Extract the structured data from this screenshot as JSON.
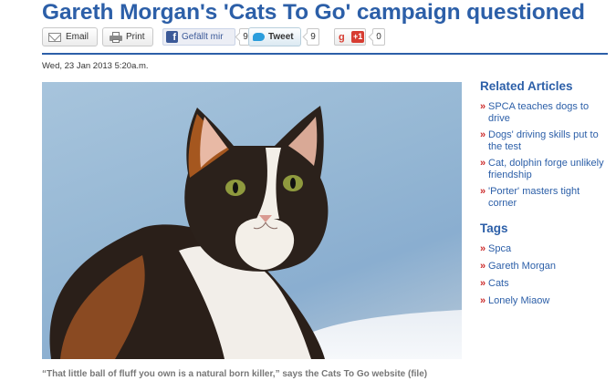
{
  "article": {
    "headline": "Gareth Morgan's 'Cats To Go' campaign questioned",
    "dateline": "Wed, 23 Jan 2013 5:20a.m.",
    "caption": "“That little ball of fluff you own is a natural born killer,” says the Cats To Go website (file)"
  },
  "share": {
    "email_label": "Email",
    "print_label": "Print",
    "facebook_label": "Gefällt mir",
    "facebook_count": "9",
    "tweet_label": "Tweet",
    "tweet_count": "9",
    "gplus_label": "+1",
    "gplus_count": "0",
    "colors": {
      "facebook": "#3b5998",
      "twitter": "#2a9ddc",
      "gplus": "#d73d32"
    }
  },
  "sidebar": {
    "related_title": "Related Articles",
    "related": [
      {
        "label": "SPCA teaches dogs to drive"
      },
      {
        "label": "Dogs' driving skills put to the test"
      },
      {
        "label": "Cat, dolphin forge unlikely friendship"
      },
      {
        "label": "'Porter' masters tight corner"
      }
    ],
    "tags_title": "Tags",
    "tags": [
      {
        "label": "Spca"
      },
      {
        "label": "Gareth Morgan"
      },
      {
        "label": "Cats"
      },
      {
        "label": "Lonely Miaow"
      }
    ]
  },
  "theme": {
    "accent": "#2c5fa8",
    "bullet": "#cc2b2b"
  }
}
